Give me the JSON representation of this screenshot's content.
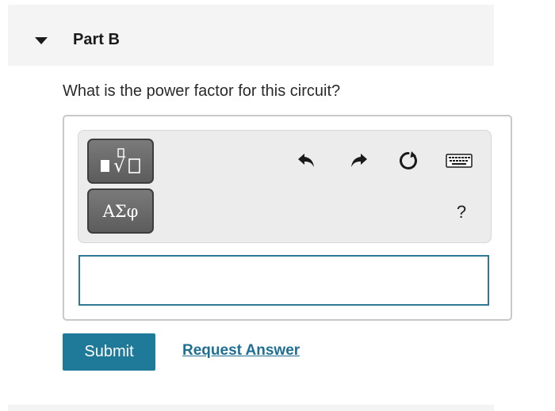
{
  "part": {
    "title": "Part B"
  },
  "question": {
    "text": "What is the power factor for this circuit?"
  },
  "toolbar": {
    "templates_icon": "templates-icon",
    "symbols_label": "ΑΣφ",
    "undo_icon": "undo-icon",
    "redo_icon": "redo-icon",
    "reset_icon": "reset-icon",
    "keyboard_icon": "keyboard-icon",
    "help_label": "?"
  },
  "answer": {
    "value": "",
    "placeholder": ""
  },
  "actions": {
    "submit_label": "Submit",
    "request_answer_label": "Request Answer"
  },
  "colors": {
    "accent": "#1f7a99",
    "link": "#1f6f95",
    "input_border": "#2e7a96"
  }
}
